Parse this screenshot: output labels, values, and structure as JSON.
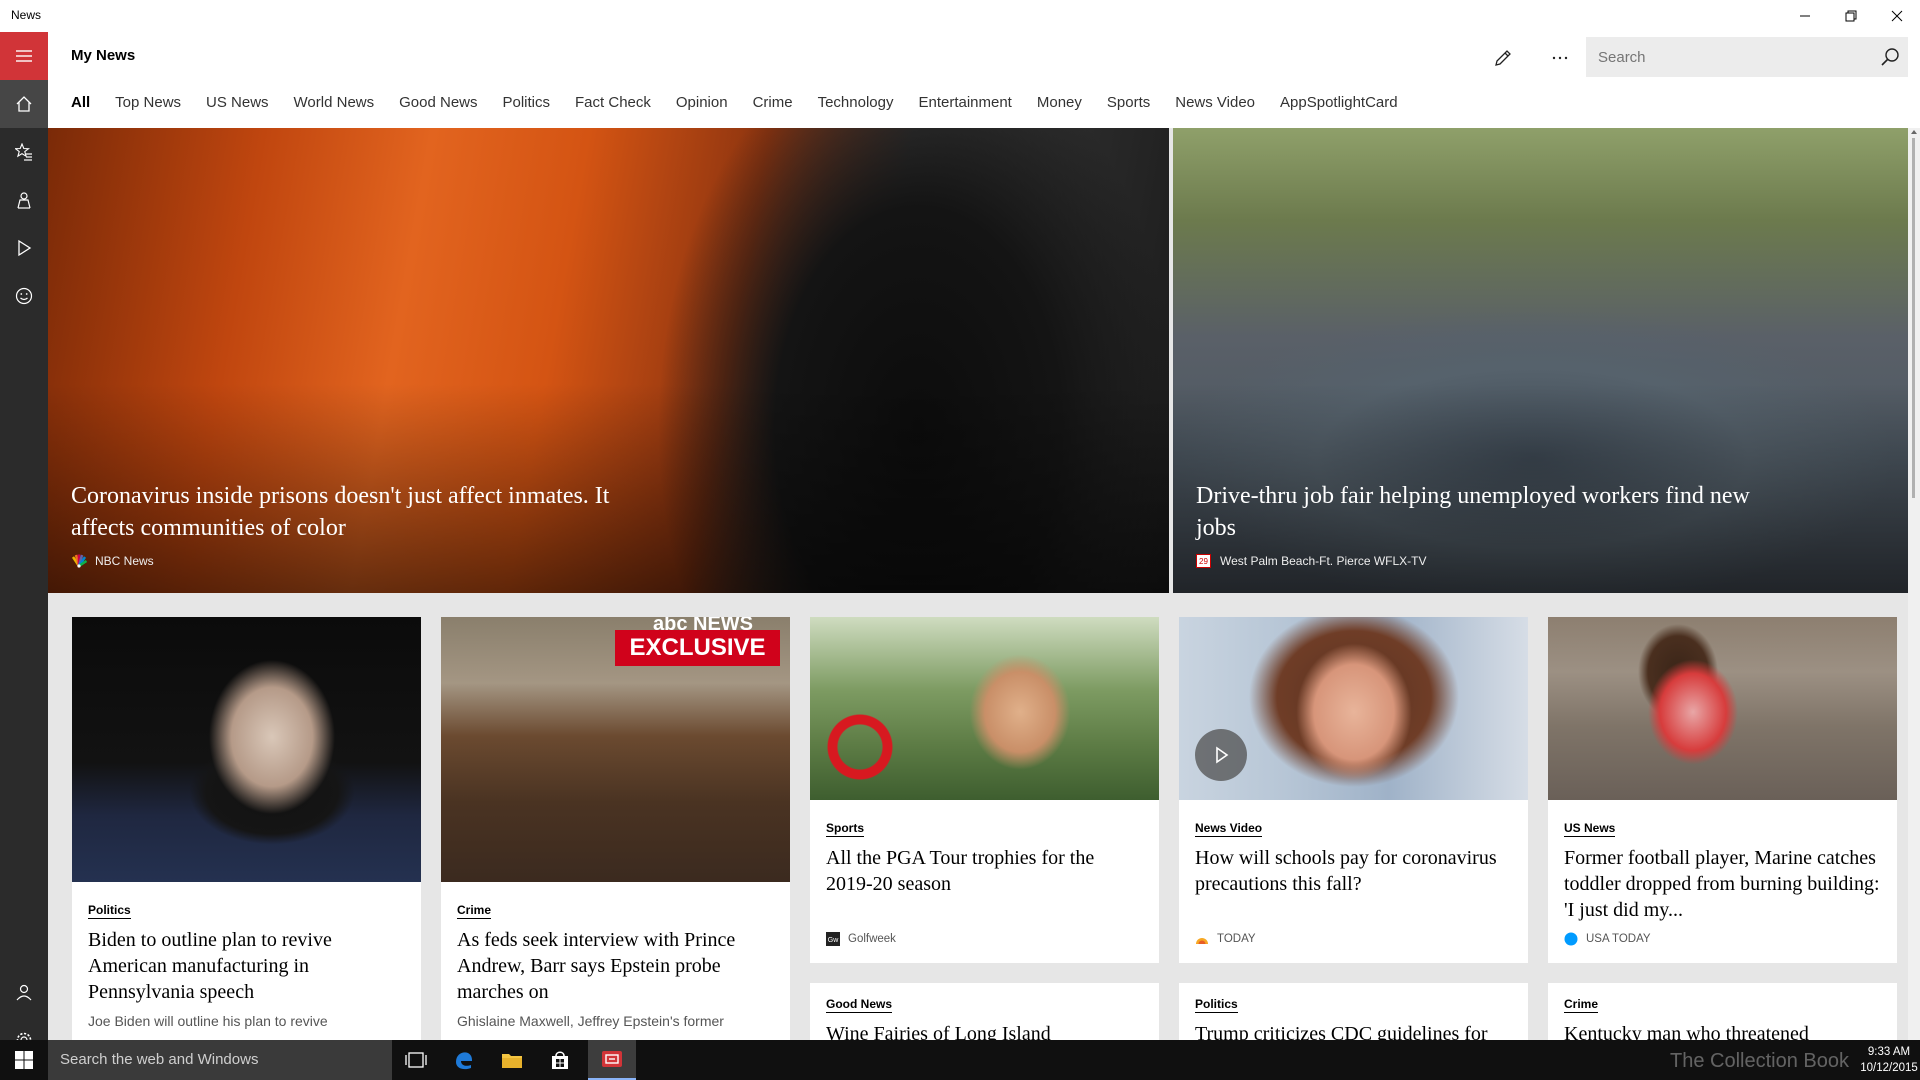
{
  "window": {
    "title": "News"
  },
  "header": {
    "title": "My News",
    "search_placeholder": "Search"
  },
  "tabs": [
    {
      "label": "All"
    },
    {
      "label": "Top News"
    },
    {
      "label": "US News"
    },
    {
      "label": "World News"
    },
    {
      "label": "Good News"
    },
    {
      "label": "Politics"
    },
    {
      "label": "Fact Check"
    },
    {
      "label": "Opinion"
    },
    {
      "label": "Crime"
    },
    {
      "label": "Technology"
    },
    {
      "label": "Entertainment"
    },
    {
      "label": "Money"
    },
    {
      "label": "Sports"
    },
    {
      "label": "News Video"
    },
    {
      "label": "AppSpotlightCard"
    }
  ],
  "heroes": [
    {
      "headline": "Coronavirus inside prisons doesn't just affect inmates. It affects communities of color",
      "source": "NBC News"
    },
    {
      "headline": "Drive-thru job fair helping unemployed workers find new jobs",
      "source": "West Palm Beach-Ft. Pierce WFLX-TV"
    }
  ],
  "cards": [
    {
      "category": "Politics",
      "title": "Biden to outline plan to revive American manufacturing in Pennsylvania speech",
      "summary": "Joe Biden will outline his plan to revive"
    },
    {
      "category": "Crime",
      "title": "As feds seek interview with Prince Andrew, Barr says Epstein probe marches on",
      "summary": "Ghislaine Maxwell, Jeffrey Epstein's former",
      "badge": "EXCLUSIVE",
      "brand": "abc NEWS"
    },
    {
      "category": "Sports",
      "title": "All the PGA Tour trophies for the 2019-20 season",
      "source": "Golfweek"
    },
    {
      "category": "News Video",
      "title": "How will schools pay for coronavirus precautions this fall?",
      "source": "TODAY"
    },
    {
      "category": "US News",
      "title": "Former football player, Marine catches toddler dropped from burning building: 'I just did my...",
      "source": "USA TODAY"
    },
    {
      "category": "Good News",
      "title": "Wine Fairies of Long Island"
    },
    {
      "category": "Politics",
      "title": "Trump criticizes CDC guidelines for"
    },
    {
      "category": "Crime",
      "title": "Kentucky man who threatened"
    }
  ],
  "taskbar": {
    "search_placeholder": "Search the web and Windows",
    "time": "9:33 AM",
    "date": "10/12/2015",
    "watermark": "The Collection Book"
  },
  "colors": {
    "accent": "#d13438",
    "rail": "#2b2b2b",
    "taskbar": "#101010"
  }
}
